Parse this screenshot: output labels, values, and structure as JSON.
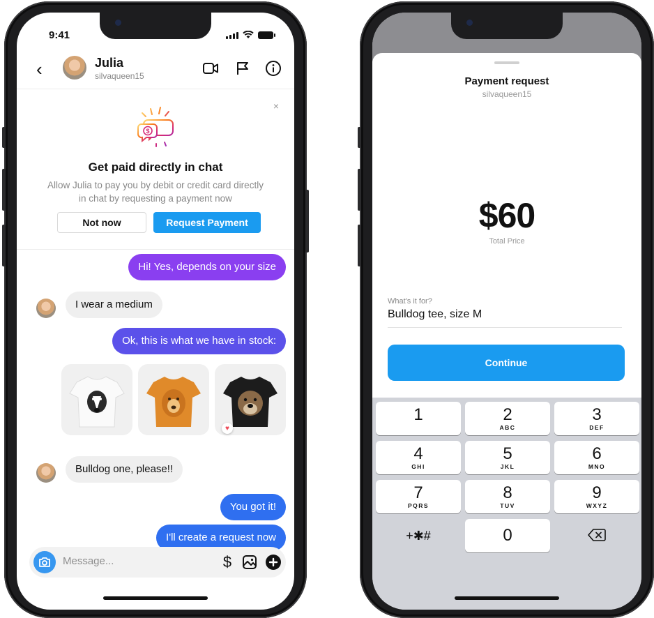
{
  "left_phone": {
    "status": {
      "time": "9:41"
    },
    "header": {
      "contact_name": "Julia",
      "contact_handle": "silvaqueen15"
    },
    "promo_card": {
      "close_glyph": "×",
      "title": "Get paid directly in chat",
      "body": "Allow Julia to pay you by debit or credit card directly in chat by requesting a payment now",
      "not_now_label": "Not now",
      "request_label": "Request Payment"
    },
    "messages": {
      "m1": "Hi! Yes, depends on your size",
      "m2": "I wear a medium",
      "m3": "Ok, this is what we have in stock:",
      "m4": "Bulldog one, please!!",
      "m5": "You got it!",
      "m6": "I'll create a request now"
    },
    "composer": {
      "placeholder": "Message...",
      "dollar_glyph": "$"
    }
  },
  "right_phone": {
    "sheet": {
      "title": "Payment request",
      "subtitle": "silvaqueen15",
      "amount": "$60",
      "amount_label": "Total Price",
      "for_label": "What's it for?",
      "for_value": "Bulldog tee, size M",
      "continue_label": "Continue"
    },
    "keypad": {
      "keys": [
        {
          "num": "1",
          "letters": ""
        },
        {
          "num": "2",
          "letters": "ABC"
        },
        {
          "num": "3",
          "letters": "DEF"
        },
        {
          "num": "4",
          "letters": "GHI"
        },
        {
          "num": "5",
          "letters": "JKL"
        },
        {
          "num": "6",
          "letters": "MNO"
        },
        {
          "num": "7",
          "letters": "PQRS"
        },
        {
          "num": "8",
          "letters": "TUV"
        },
        {
          "num": "9",
          "letters": "WXYZ"
        }
      ],
      "symbols": "+✱#",
      "zero": "0"
    }
  },
  "colors": {
    "accent_blue": "#1a9bf0",
    "bubble_purple": "#8a3ff0",
    "bubble_indigo": "#5b51ea",
    "bubble_blue": "#2f6ff0",
    "like_red": "#ed4956"
  },
  "icons": {
    "left_header": [
      "back-icon",
      "video-camera-icon",
      "flag-icon",
      "info-icon"
    ],
    "composer": [
      "camera-icon",
      "dollar-icon",
      "gallery-icon",
      "plus-icon"
    ],
    "keypad": [
      "delete-icon"
    ]
  }
}
